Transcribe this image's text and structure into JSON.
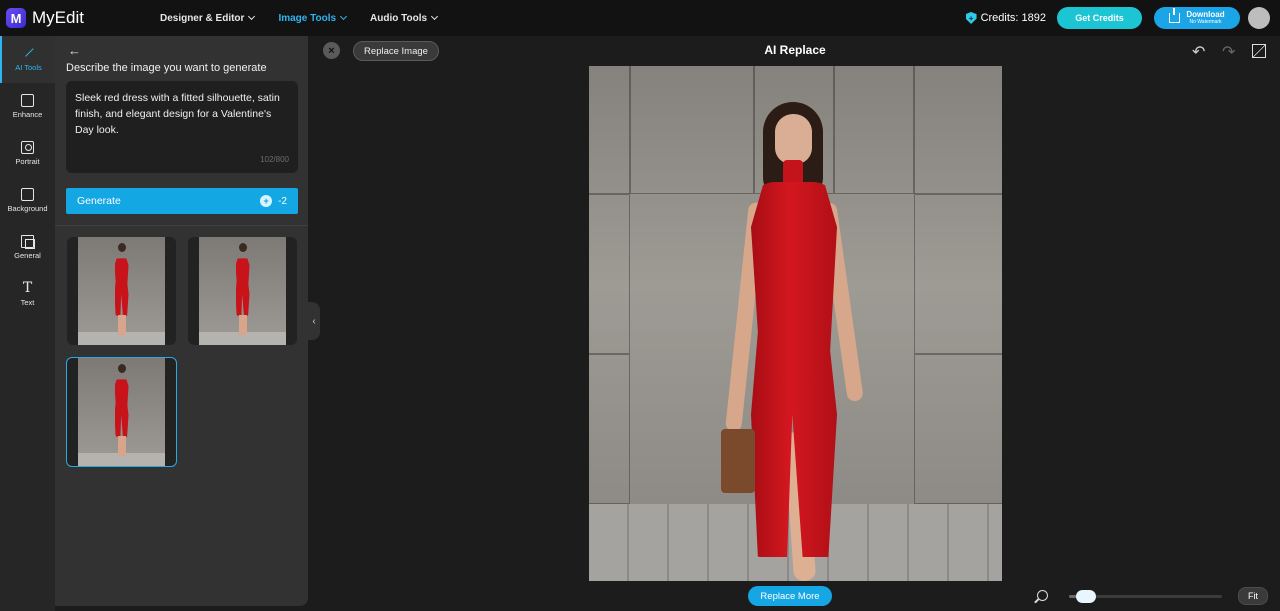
{
  "app": {
    "name": "MyEdit",
    "logo_letter": "M"
  },
  "nav": [
    {
      "label": "Designer & Editor",
      "active": false
    },
    {
      "label": "Image Tools",
      "active": true
    },
    {
      "label": "Audio Tools",
      "active": false
    }
  ],
  "account": {
    "credits_label": "Credits: 1892",
    "get_credits": "Get Credits",
    "download": "Download",
    "download_sub": "No Watermark"
  },
  "sidebar": [
    {
      "label": "AI Tools",
      "icon": "wand-icon",
      "active": true
    },
    {
      "label": "Enhance",
      "icon": "image-enhance-icon"
    },
    {
      "label": "Portrait",
      "icon": "portrait-icon"
    },
    {
      "label": "Background",
      "icon": "background-icon"
    },
    {
      "label": "General",
      "icon": "general-icon"
    },
    {
      "label": "Text",
      "icon": "text-icon"
    }
  ],
  "panel": {
    "heading": "Describe the image you want to generate",
    "prompt_text": "Sleek red dress with a fitted silhouette, satin finish, and elegant design for a Valentine's Day look.",
    "char_count": "102/800",
    "generate_label": "Generate",
    "generate_cost": "-2",
    "results": [
      {
        "selected": false
      },
      {
        "selected": false
      },
      {
        "selected": true
      }
    ]
  },
  "editor": {
    "title": "AI Replace",
    "replace_image": "Replace Image",
    "replace_more": "Replace More",
    "fit_label": "Fit",
    "zoom_level": 0.05
  }
}
